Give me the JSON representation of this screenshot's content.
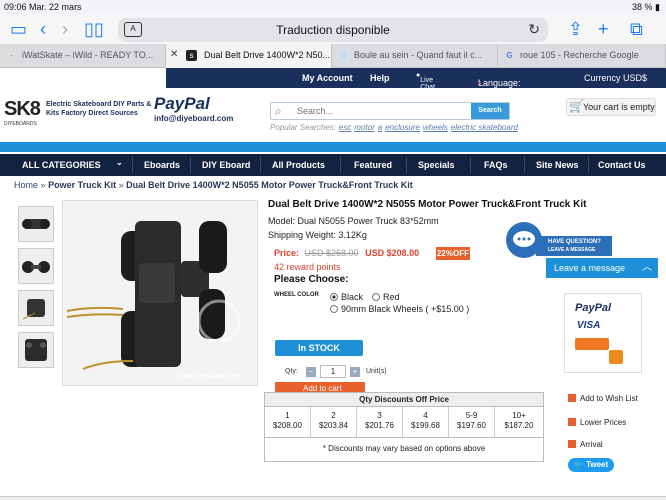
{
  "status": {
    "time": "09:06",
    "date": "Mar. 22 mars",
    "battery": "38 %"
  },
  "toolbar": {
    "url_text": "Traduction disponible"
  },
  "tabs": [
    {
      "label": "iWatSkate – iWild - READY TO..."
    },
    {
      "label": "Dual Belt Drive 1400W*2 N50..."
    },
    {
      "label": "Boule au sein - Quand faut il c..."
    },
    {
      "label": "roue 105 - Recherche Google"
    }
  ],
  "topnav": {
    "account": "My Account",
    "help": "Help",
    "live_chat": "Live Chat",
    "language": "Language: English",
    "currency": "Currency USD$"
  },
  "header": {
    "logo": "SK8",
    "logo_sub": "DIYEBOARDS",
    "tagline_1": "Electric Skateboard DIY Parts &",
    "tagline_2": "Kits Factory Direct Sources",
    "paypal": "PayPal",
    "email": "info@diyeboard.com",
    "search_placeholder": "Search...",
    "search_button": "Search",
    "popular_label": "Popular Searches:",
    "popular": [
      "esc",
      "motor",
      "a",
      "enclosure",
      "wheels",
      "electric skateboard"
    ],
    "cart": "Your cart is empty"
  },
  "catnav": [
    "ALL CATEGORIES",
    "Eboards",
    "DIY Eboard",
    "All Products",
    "Featured",
    "Specials",
    "FAQs",
    "Site News",
    "Contact Us"
  ],
  "breadcrumb": {
    "home": "Home",
    "sep": "»",
    "cat": "Power Truck Kit",
    "current": "Dual Belt Drive 1400W*2 N5055 Motor Power Truck&Front Truck Kit"
  },
  "product": {
    "title": "Dual Belt Drive 1400W*2 N5055 Motor Power Truck&Front Truck Kit",
    "model": "Model: Dual N5055 Power Truck 83*52mm",
    "weight": "Shipping Weight: 3.12Kg",
    "price_label": "Price:",
    "old_price": "USD $268.00",
    "new_price": "USD $208.00",
    "off": "22%OFF",
    "reward": "42 reward points",
    "choose": "Please Choose:",
    "wheel_color": "WHEEL COLOR",
    "options": [
      "Black",
      "Red",
      "90mm Black Wheels ( +$15.00 )"
    ],
    "instock": "In STOCK",
    "qty_label": "Qty:",
    "qty_value": "1",
    "units": "Unit(s)",
    "add_to_cart": "Add to cart",
    "image_watermark": "www.diyeboard.com"
  },
  "discounts": {
    "header": "Qty Discounts Off Price",
    "cols": [
      {
        "qty": "1",
        "price": "$208.00"
      },
      {
        "qty": "2",
        "price": "$203.84"
      },
      {
        "qty": "3",
        "price": "$201.76"
      },
      {
        "qty": "4",
        "price": "$199.68"
      },
      {
        "qty": "5-9",
        "price": "$197.60"
      },
      {
        "qty": "10+",
        "price": "$187.20"
      }
    ],
    "note": "* Discounts may vary based on options above"
  },
  "side": {
    "paypal": "PayPal",
    "visa": "VISA",
    "wishlist": "Add to Wish List",
    "lower": "Lower Prices",
    "arrival": "Arrival",
    "tweet": "Tweet"
  },
  "chat": {
    "have_q": "HAVE QUESTION?",
    "leave": "LEAVE A MESSAGE",
    "leave_msg": "Leave a message"
  },
  "colors": {
    "navy": "#13233f",
    "blue": "#1e90d8",
    "orange": "#e8602c",
    "red": "#d9432d"
  }
}
